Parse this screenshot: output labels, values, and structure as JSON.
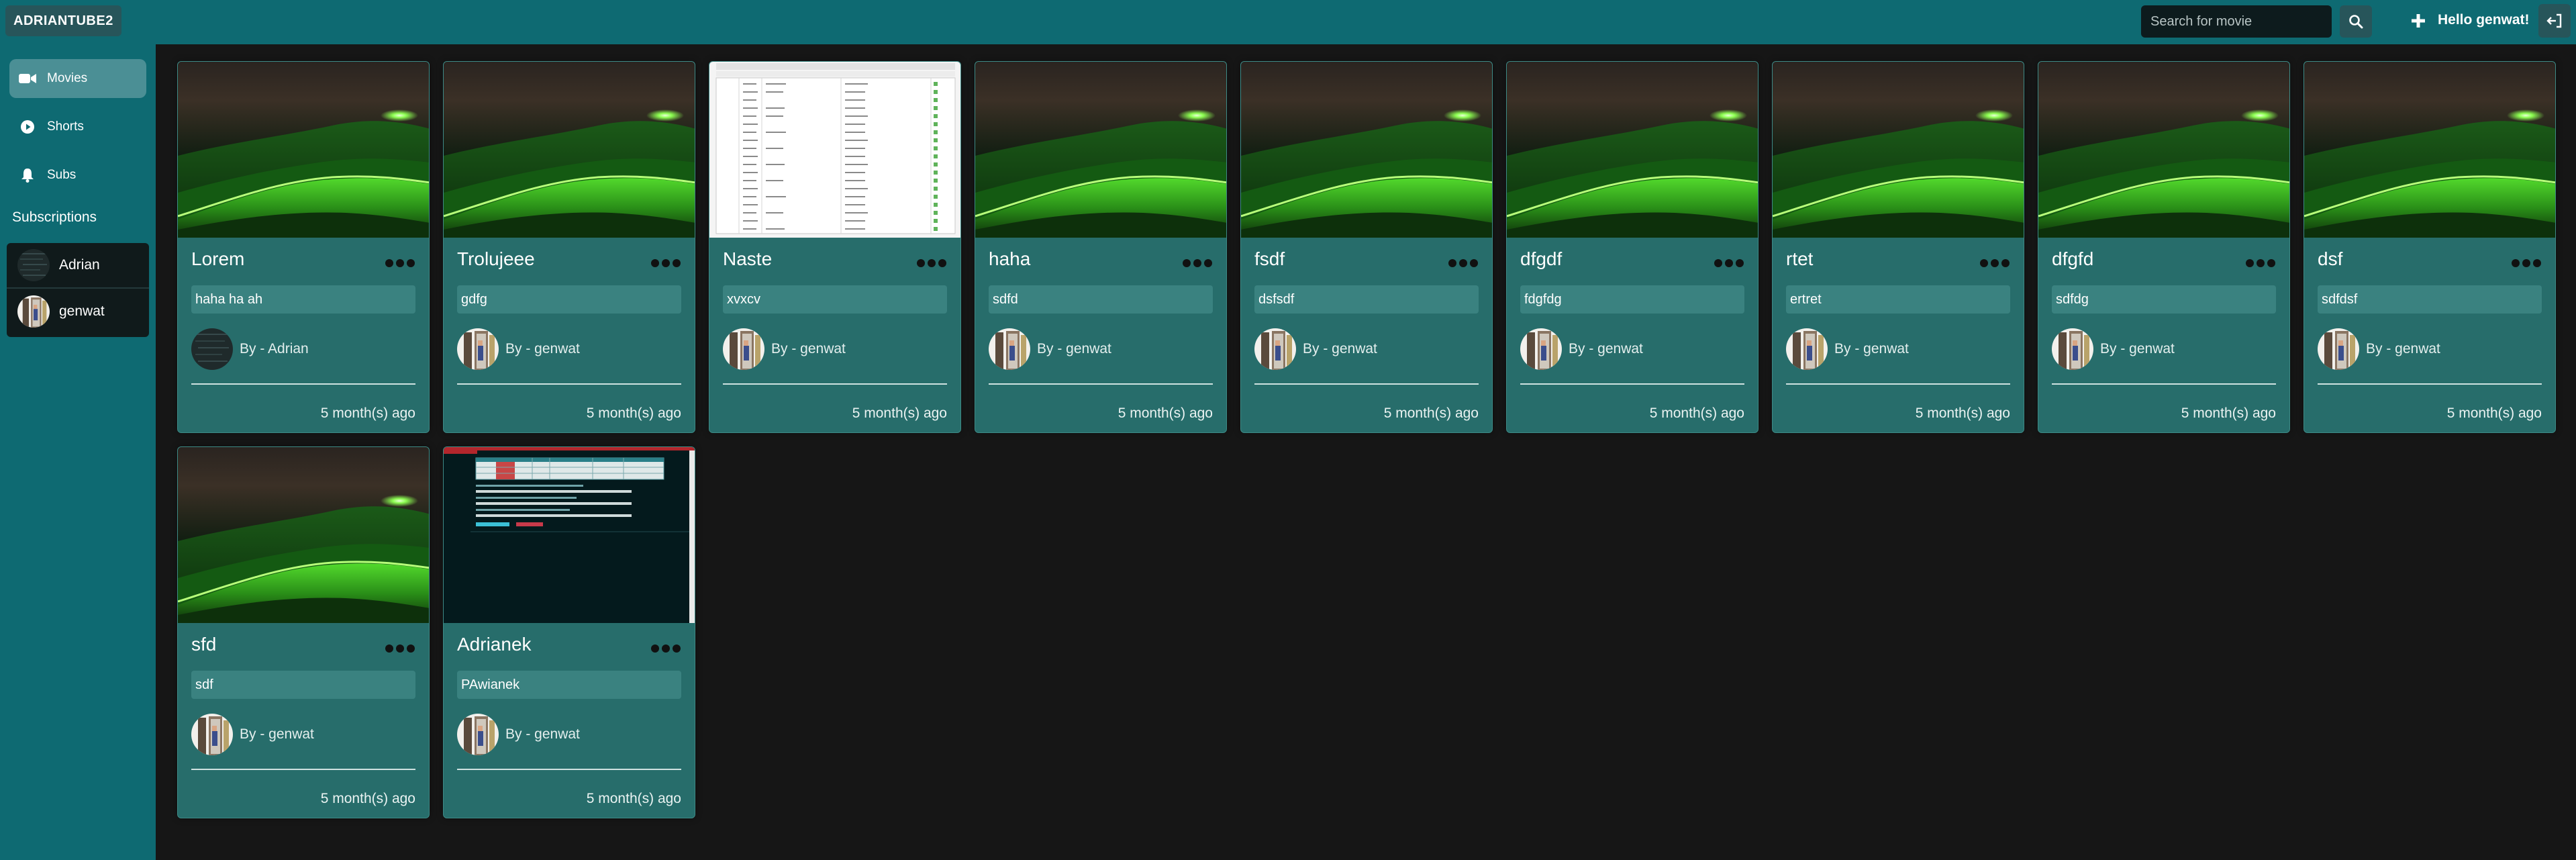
{
  "app": {
    "brand": "ADRIANTUBE2"
  },
  "header": {
    "search": {
      "placeholder": "Search for movie",
      "value": ""
    },
    "greeting_prefix": "Hello ",
    "username": "genwat!"
  },
  "sidebar": {
    "nav": [
      {
        "label": "Movies",
        "icon": "video-camera-icon",
        "active": true
      },
      {
        "label": "Shorts",
        "icon": "play-circle-icon",
        "active": false
      },
      {
        "label": "Subs",
        "icon": "bell-icon",
        "active": false
      }
    ],
    "subscriptions_heading": "Subscriptions",
    "subscriptions": [
      {
        "name": "Adrian",
        "avatar": "dark-avatar"
      },
      {
        "name": "genwat",
        "avatar": "doorway-avatar"
      }
    ]
  },
  "movies": [
    {
      "title": "Lorem",
      "description": "haha ha ah",
      "author": "By - Adrian",
      "age": "5 month(s) ago",
      "thumbnail": "green-waves",
      "avatar": "dark-avatar"
    },
    {
      "title": "Trolujeee",
      "description": "gdfg",
      "author": "By - genwat",
      "age": "5 month(s) ago",
      "thumbnail": "green-waves",
      "avatar": "doorway-avatar"
    },
    {
      "title": "Naste",
      "description": "xvxcv",
      "author": "By - genwat",
      "age": "5 month(s) ago",
      "thumbnail": "spreadsheet-screenshot",
      "avatar": "doorway-avatar"
    },
    {
      "title": "haha",
      "description": "sdfd",
      "author": "By - genwat",
      "age": "5 month(s) ago",
      "thumbnail": "green-waves",
      "avatar": "doorway-avatar"
    },
    {
      "title": "fsdf",
      "description": "dsfsdf",
      "author": "By - genwat",
      "age": "5 month(s) ago",
      "thumbnail": "green-waves",
      "avatar": "doorway-avatar"
    },
    {
      "title": "dfgdf",
      "description": "fdgfdg",
      "author": "By - genwat",
      "age": "5 month(s) ago",
      "thumbnail": "green-waves",
      "avatar": "doorway-avatar"
    },
    {
      "title": "rtet",
      "description": "ertret",
      "author": "By - genwat",
      "age": "5 month(s) ago",
      "thumbnail": "green-waves",
      "avatar": "doorway-avatar"
    },
    {
      "title": "dfgfd",
      "description": "sdfdg",
      "author": "By - genwat",
      "age": "5 month(s) ago",
      "thumbnail": "green-waves",
      "avatar": "doorway-avatar"
    },
    {
      "title": "dsf",
      "description": "sdfdsf",
      "author": "By - genwat",
      "age": "5 month(s) ago",
      "thumbnail": "green-waves",
      "avatar": "doorway-avatar"
    },
    {
      "title": "sfd",
      "description": "sdf",
      "author": "By - genwat",
      "age": "5 month(s) ago",
      "thumbnail": "green-waves",
      "avatar": "doorway-avatar"
    },
    {
      "title": "Adrianek",
      "description": "PAwianek",
      "author": "By - genwat",
      "age": "5 month(s) ago",
      "thumbnail": "admin-table-screenshot",
      "avatar": "doorway-avatar"
    }
  ],
  "colors": {
    "topbar": "#0e6a72",
    "sidebar": "#0e6a72",
    "card": "#276d6b",
    "page_background": "#161616",
    "accent_button": "#27555a"
  }
}
